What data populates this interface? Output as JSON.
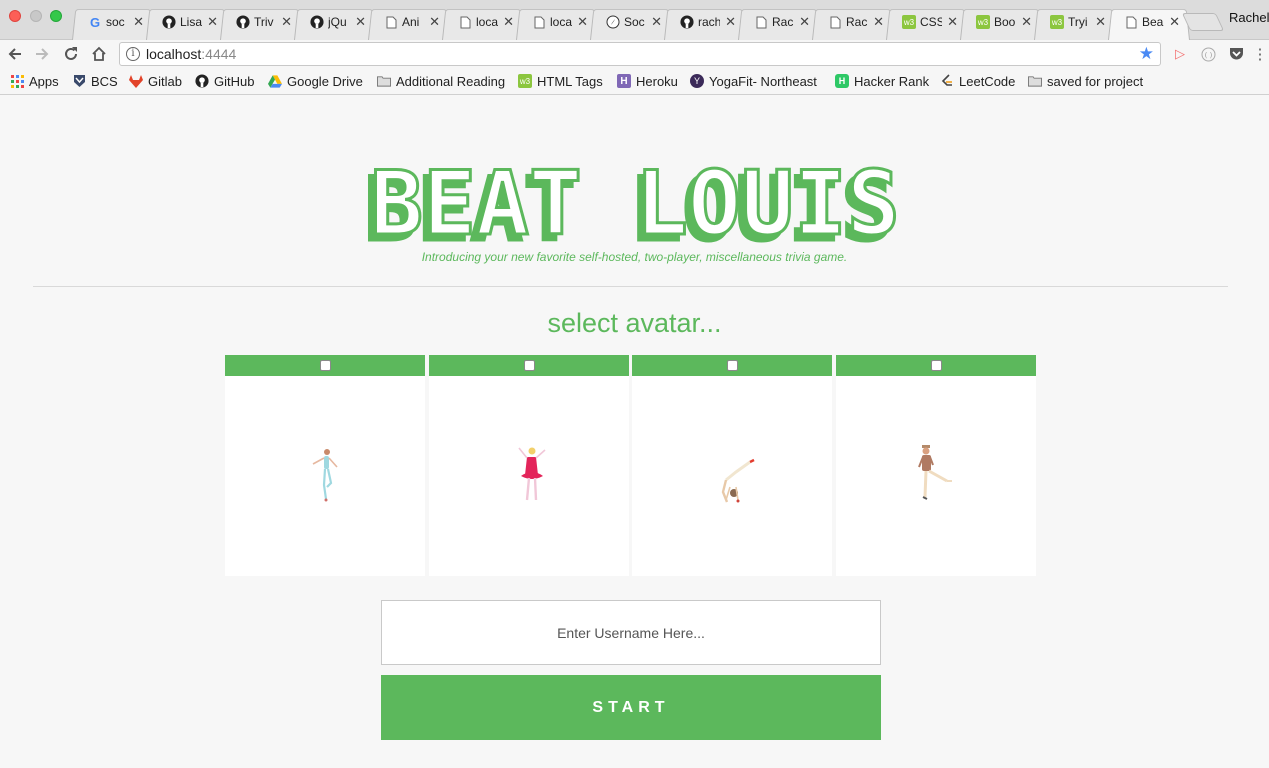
{
  "browser": {
    "tabs": [
      {
        "title": "soc",
        "icon": "google-icon"
      },
      {
        "title": "Lisa",
        "icon": "github-icon"
      },
      {
        "title": "Triv",
        "icon": "github-icon"
      },
      {
        "title": "jQu",
        "icon": "github-icon"
      },
      {
        "title": "Ani",
        "icon": "document-icon"
      },
      {
        "title": "loca",
        "icon": "document-icon"
      },
      {
        "title": "loca",
        "icon": "document-icon"
      },
      {
        "title": "Soc",
        "icon": "compass-icon"
      },
      {
        "title": "rach",
        "icon": "github-icon"
      },
      {
        "title": "Rac",
        "icon": "document-icon"
      },
      {
        "title": "Rac",
        "icon": "document-icon"
      },
      {
        "title": "CSS",
        "icon": "w3schools-icon"
      },
      {
        "title": "Boo",
        "icon": "w3schools-icon"
      },
      {
        "title": "Tryi",
        "icon": "w3schools-icon"
      },
      {
        "title": "Bea",
        "icon": "document-icon",
        "active": true
      }
    ],
    "profile_name": "Rachel",
    "url_host": "localhost",
    "url_port": ":4444",
    "bookmarks": [
      {
        "label": "Apps",
        "icon": "apps-grid-icon"
      },
      {
        "label": "BCS",
        "icon": "bcs-icon"
      },
      {
        "label": "Gitlab",
        "icon": "gitlab-icon"
      },
      {
        "label": "GitHub",
        "icon": "github-icon"
      },
      {
        "label": "Google Drive",
        "icon": "google-drive-icon"
      },
      {
        "label": "Additional Reading",
        "icon": "folder-icon"
      },
      {
        "label": "HTML Tags",
        "icon": "w3schools-icon"
      },
      {
        "label": "Heroku",
        "icon": "heroku-icon"
      },
      {
        "label": "YogaFit- Northeast",
        "icon": "yogafit-icon"
      },
      {
        "label": "Hacker Rank",
        "icon": "hackerrank-icon"
      },
      {
        "label": "LeetCode",
        "icon": "leetcode-icon"
      },
      {
        "label": "saved for project",
        "icon": "folder-icon"
      }
    ]
  },
  "page": {
    "logo_text": "BEAT LOUIS",
    "tagline": "Introducing your new favorite self-hosted, two-player, miscellaneous trivia game.",
    "select_heading": "select avatar...",
    "avatars": [
      {
        "name": "dancer-blue",
        "checked": false
      },
      {
        "name": "ballerina-pink",
        "checked": false
      },
      {
        "name": "dancer-cartwheel",
        "checked": false
      },
      {
        "name": "dancer-kick",
        "checked": false
      }
    ],
    "username_placeholder": "Enter Username Here...",
    "username_value": "",
    "start_label": "START"
  },
  "colors": {
    "accent": "#5cb85c",
    "background": "#f7f7f7"
  }
}
